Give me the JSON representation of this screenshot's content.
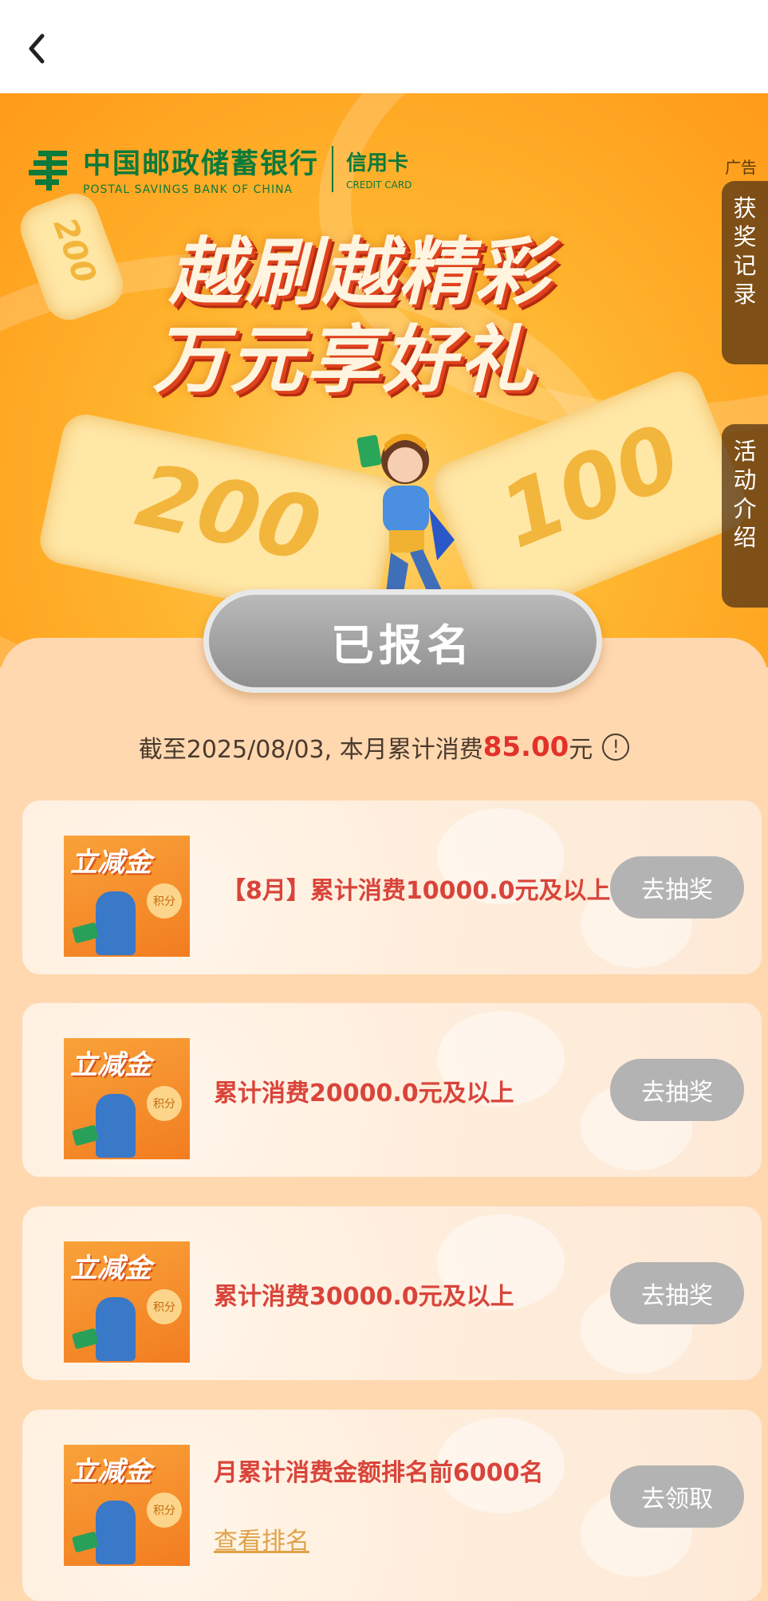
{
  "banner": {
    "bank_name_cn": "中国邮政储蓄银行",
    "bank_name_en": "POSTAL SAVINGS BANK OF CHINA",
    "card_cn": "信用卡",
    "card_en": "CREDIT CARD",
    "ad_label": "广告",
    "headline_1": "越刷越精彩",
    "headline_2": "万元享好礼",
    "ticket_left": "200",
    "ticket_right": "100",
    "ticket_small": "200"
  },
  "side_tabs": [
    {
      "label": "获奖记录"
    },
    {
      "label": "活动介绍"
    }
  ],
  "status_button": "已报名",
  "summary": {
    "prefix": "截至2025/08/03, 本月累计消费",
    "amount": "85.00",
    "suffix": "元",
    "info_icon": "!"
  },
  "cards": [
    {
      "thumb_title": "立减金",
      "thumb_badge": "积分",
      "title": "【8月】累计消费10000.0元及以上",
      "action": "去抽奖"
    },
    {
      "thumb_title": "立减金",
      "thumb_badge": "积分",
      "title": "累计消费20000.0元及以上",
      "action": "去抽奖"
    },
    {
      "thumb_title": "立减金",
      "thumb_badge": "积分",
      "title": "累计消费30000.0元及以上",
      "action": "去抽奖"
    },
    {
      "thumb_title": "立减金",
      "thumb_badge": "积分",
      "title": "月累计消费金额排名前6000名",
      "action": "去领取",
      "link": "查看排名"
    }
  ],
  "colors": {
    "accent_red": "#e2322a",
    "brand_green": "#0b7a3b",
    "button_gray": "#b3b3b3"
  }
}
